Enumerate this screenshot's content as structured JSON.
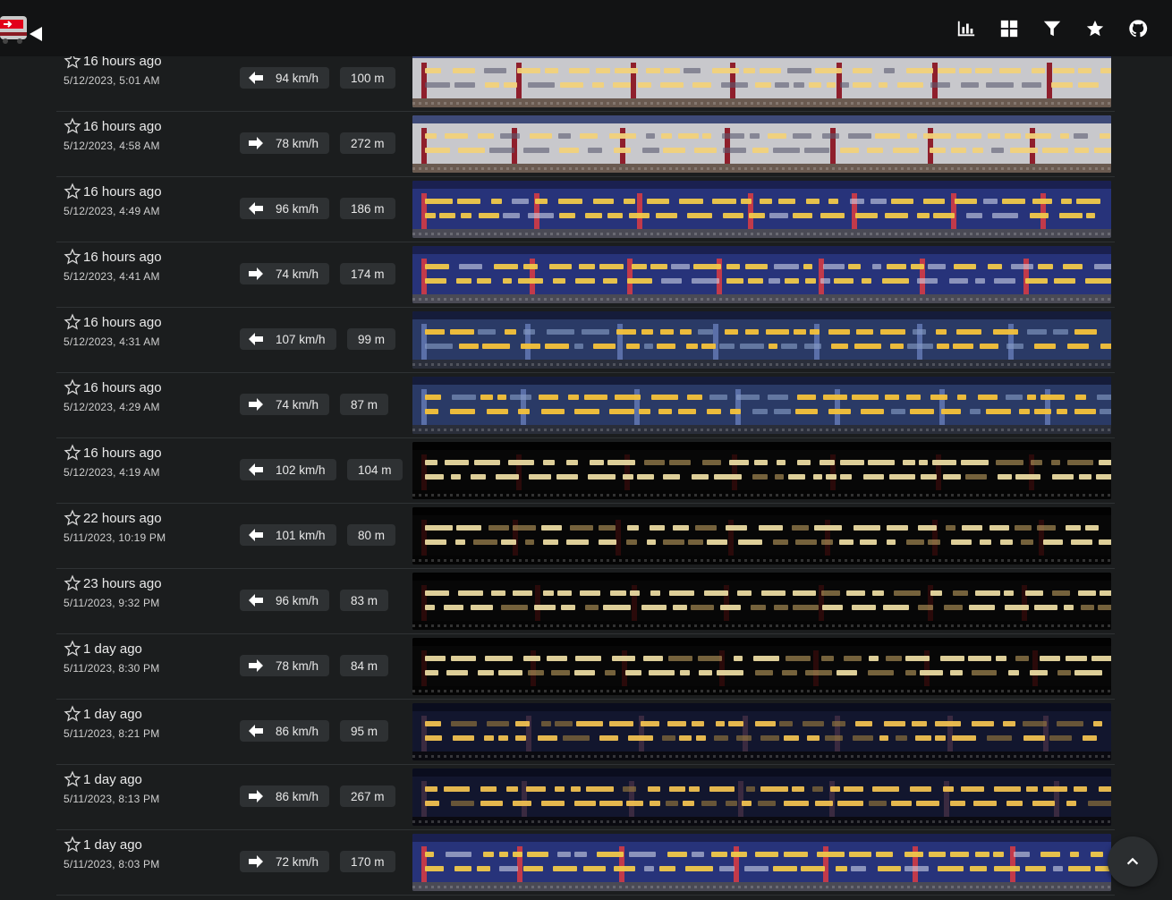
{
  "header": {
    "logo": "sbb-train-logo",
    "nav": [
      {
        "name": "stats-icon",
        "title": "stats"
      },
      {
        "name": "gallery-icon",
        "title": "gallery"
      },
      {
        "name": "filter-icon",
        "title": "filter"
      },
      {
        "name": "favorites-icon",
        "title": "favorites"
      },
      {
        "name": "github-icon",
        "title": "github"
      }
    ]
  },
  "rows": [
    {
      "rel": "16 hours ago",
      "abs": "5/12/2023, 5:01 AM",
      "dir": "left",
      "speed": "94 km/h",
      "length": "100 m",
      "theme": "day-red"
    },
    {
      "rel": "16 hours ago",
      "abs": "5/12/2023, 4:58 AM",
      "dir": "right",
      "speed": "78 km/h",
      "length": "272 m",
      "theme": "day-red"
    },
    {
      "rel": "16 hours ago",
      "abs": "5/12/2023, 4:49 AM",
      "dir": "left",
      "speed": "96 km/h",
      "length": "186 m",
      "theme": "dusk-blue"
    },
    {
      "rel": "16 hours ago",
      "abs": "5/12/2023, 4:41 AM",
      "dir": "right",
      "speed": "74 km/h",
      "length": "174 m",
      "theme": "dusk-blue"
    },
    {
      "rel": "16 hours ago",
      "abs": "5/12/2023, 4:31 AM",
      "dir": "left",
      "speed": "107 km/h",
      "length": "99 m",
      "theme": "dusk-light"
    },
    {
      "rel": "16 hours ago",
      "abs": "5/12/2023, 4:29 AM",
      "dir": "right",
      "speed": "74 km/h",
      "length": "87 m",
      "theme": "dusk-light"
    },
    {
      "rel": "16 hours ago",
      "abs": "5/12/2023, 4:19 AM",
      "dir": "left",
      "speed": "102 km/h",
      "length": "104 m",
      "theme": "night"
    },
    {
      "rel": "22 hours ago",
      "abs": "5/11/2023, 10:19 PM",
      "dir": "left",
      "speed": "101 km/h",
      "length": "80 m",
      "theme": "night"
    },
    {
      "rel": "23 hours ago",
      "abs": "5/11/2023, 9:32 PM",
      "dir": "left",
      "speed": "96 km/h",
      "length": "83 m",
      "theme": "night"
    },
    {
      "rel": "1 day ago",
      "abs": "5/11/2023, 8:30 PM",
      "dir": "right",
      "speed": "78 km/h",
      "length": "84 m",
      "theme": "night"
    },
    {
      "rel": "1 day ago",
      "abs": "5/11/2023, 8:21 PM",
      "dir": "left",
      "speed": "86 km/h",
      "length": "95 m",
      "theme": "night-blue"
    },
    {
      "rel": "1 day ago",
      "abs": "5/11/2023, 8:13 PM",
      "dir": "right",
      "speed": "86 km/h",
      "length": "267 m",
      "theme": "night-blue"
    },
    {
      "rel": "1 day ago",
      "abs": "5/11/2023, 8:03 PM",
      "dir": "right",
      "speed": "72 km/h",
      "length": "170 m",
      "theme": "dusk-blue"
    }
  ],
  "colors": {
    "background": "#1b1d1e",
    "topbar": "#121314",
    "pill": "#2e3133",
    "divider": "#2f3234"
  }
}
